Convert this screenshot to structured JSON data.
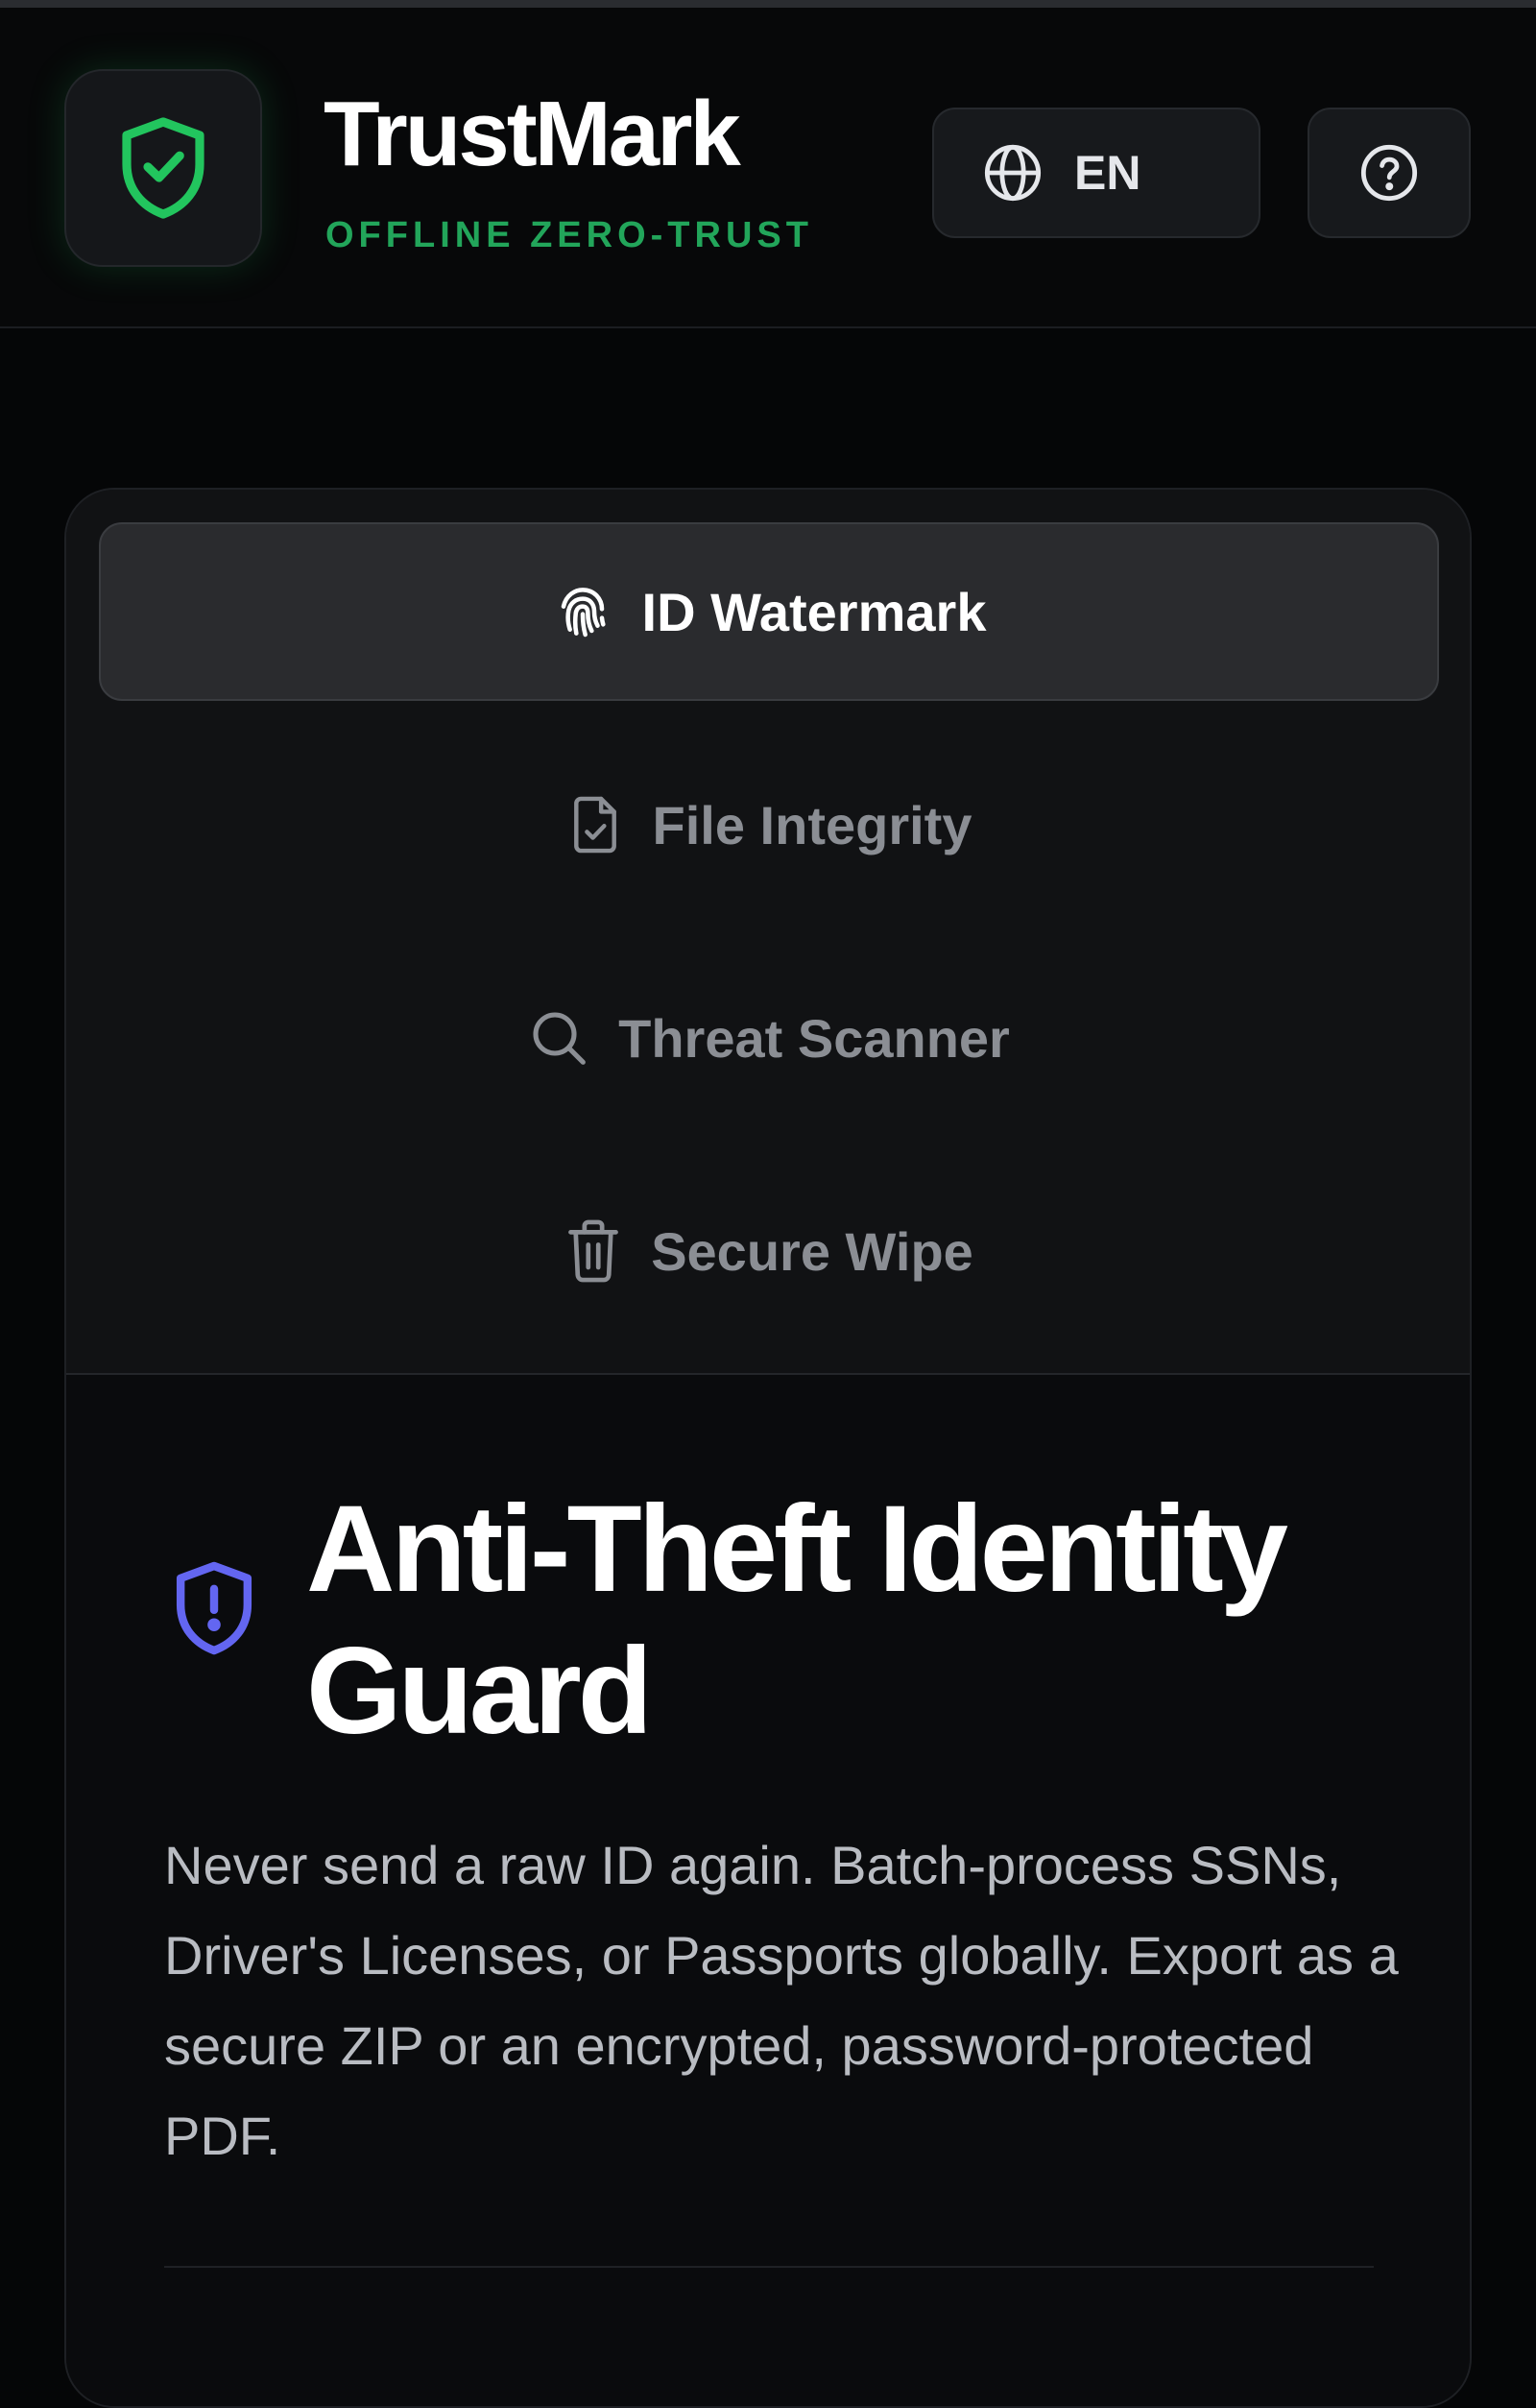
{
  "header": {
    "brand_title": "TrustMark",
    "brand_subtitle": "OFFLINE ZERO-TRUST",
    "language_label": "EN",
    "logo_icon": "shield-check-icon",
    "language_icon": "globe-icon",
    "help_icon": "question-circle-icon"
  },
  "tabs": [
    {
      "label": "ID Watermark",
      "icon": "fingerprint-icon",
      "active": true
    },
    {
      "label": "File Integrity",
      "icon": "file-check-icon",
      "active": false
    },
    {
      "label": "Threat Scanner",
      "icon": "search-icon",
      "active": false
    },
    {
      "label": "Secure Wipe",
      "icon": "trash-icon",
      "active": false
    }
  ],
  "content": {
    "icon": "shield-alert-icon",
    "heading": "Anti-Theft Identity Guard",
    "description": "Never send a raw ID again. Batch-process SSNs, Driver's Licenses, or Passports globally. Export as a secure ZIP or an encrypted, password-protected PDF."
  },
  "colors": {
    "accent_green": "#22c55e",
    "accent_indigo": "#6366f1",
    "background": "#050607"
  }
}
